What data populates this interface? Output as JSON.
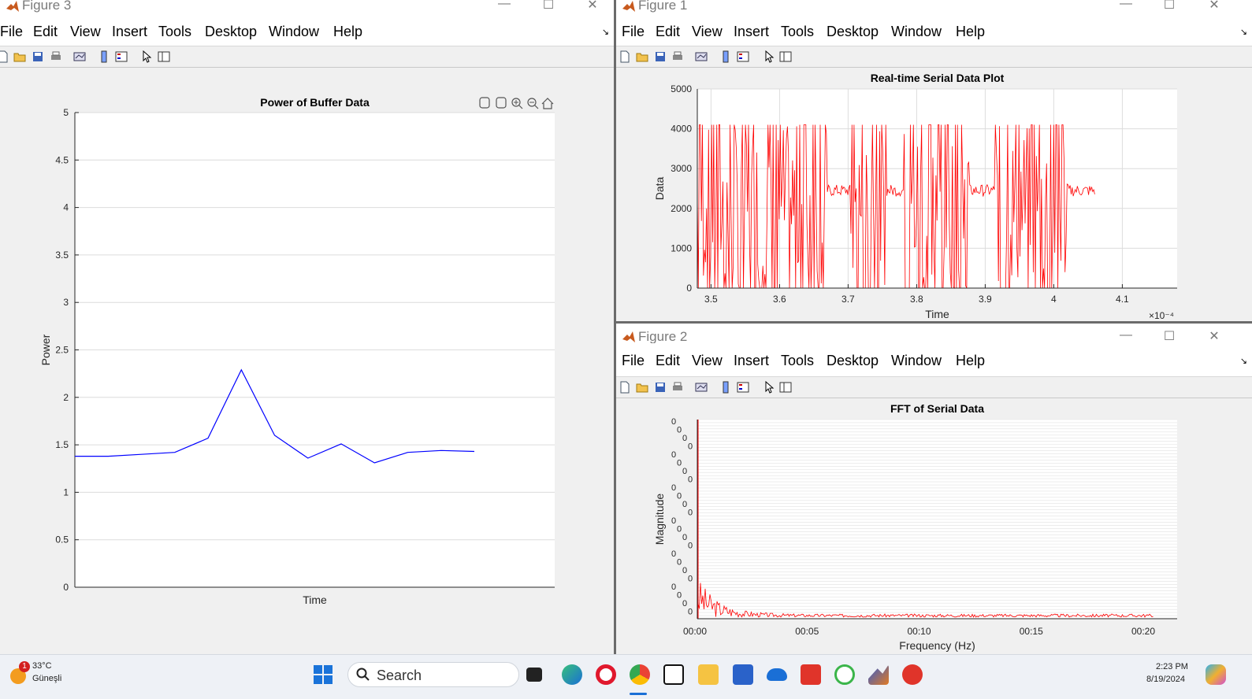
{
  "menu": [
    "File",
    "Edit",
    "View",
    "Insert",
    "Tools",
    "Desktop",
    "Window",
    "Help"
  ],
  "figure3": {
    "window_title": "Figure 3",
    "chart_data": {
      "type": "line",
      "title": "Power of Buffer Data",
      "xlabel": "Time",
      "ylabel": "Power",
      "ylim": [
        0,
        5
      ],
      "yticks": [
        "0",
        "0.5",
        "1",
        "1.5",
        "2",
        "2.5",
        "3",
        "3.5",
        "4",
        "4.5",
        "5"
      ],
      "grid": true,
      "series_color": "#0000ff",
      "x": [
        0,
        1,
        2,
        3,
        4,
        5,
        6,
        7,
        8,
        9,
        10,
        11,
        12
      ],
      "values": [
        1.38,
        1.38,
        1.4,
        1.42,
        1.57,
        2.29,
        1.6,
        1.36,
        1.51,
        1.31,
        1.42,
        1.44,
        1.43
      ]
    }
  },
  "figure1": {
    "window_title": "Figure 1",
    "chart_data": {
      "type": "line",
      "title": "Real-time Serial Data Plot",
      "xlabel": "Time",
      "ylabel": "Data",
      "xlim": [
        3.48,
        4.18
      ],
      "ylim": [
        0,
        5000
      ],
      "xticks": [
        "3.5",
        "3.6",
        "3.7",
        "3.8",
        "3.9",
        "4",
        "4.1"
      ],
      "yticks": [
        "0",
        "1000",
        "2000",
        "3000",
        "4000",
        "5000"
      ],
      "x_exponent": "×10⁻⁴",
      "grid": true,
      "series_color": "#ff0000",
      "x_range_of_data": [
        3.48,
        4.06
      ],
      "value_range_of_data": [
        0,
        4100
      ]
    }
  },
  "figure2": {
    "window_title": "Figure 2",
    "chart_data": {
      "type": "line",
      "title": "FFT of Serial Data",
      "xlabel": "Frequency (Hz)",
      "ylabel": "Magnitude",
      "xticks": [
        "00:00",
        "00:05",
        "00:10",
        "00:15",
        "00:20"
      ],
      "grid": true,
      "series_color": "#ff0000"
    }
  },
  "taskbar": {
    "weather_temp": "33°C",
    "weather_desc": "Güneşli",
    "weather_badge": "1",
    "search_label": "Search",
    "time": "2:23 PM",
    "date": "8/19/2024"
  }
}
